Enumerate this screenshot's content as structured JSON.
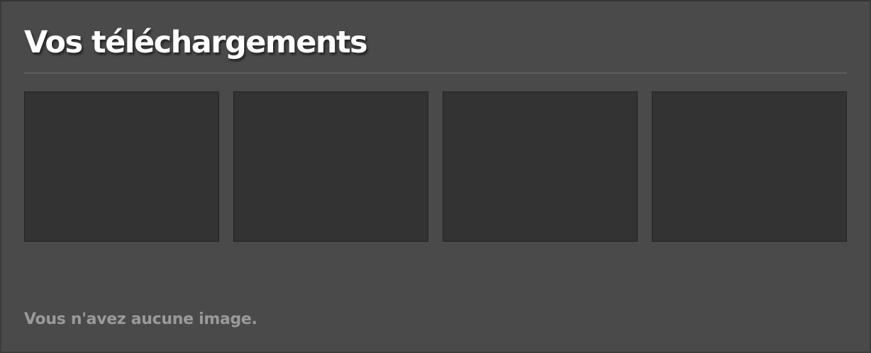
{
  "uploads": {
    "title": "Vos téléchargements",
    "slots": [
      {
        "image": ""
      },
      {
        "image": ""
      },
      {
        "image": ""
      },
      {
        "image": ""
      }
    ],
    "empty_message": "Vous n'avez aucune image."
  }
}
